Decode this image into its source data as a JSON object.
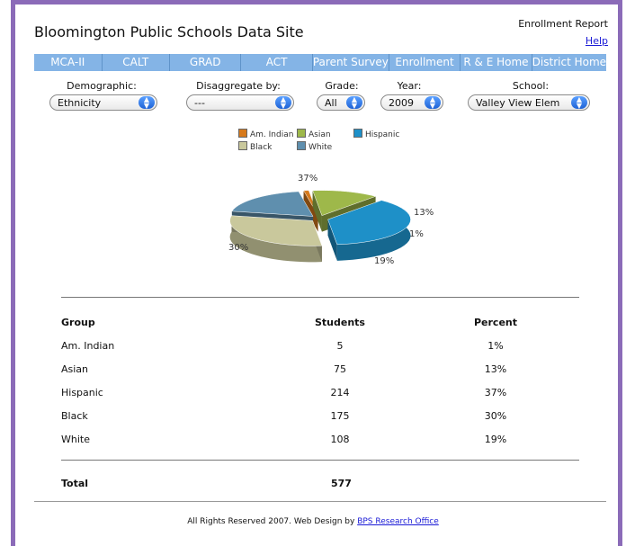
{
  "header": {
    "site_title": "Bloomington Public Schools Data Site",
    "report_title": "Enrollment Report",
    "help_link": "Help"
  },
  "nav": {
    "items": [
      "MCA-II",
      "CALT",
      "GRAD",
      "ACT",
      "Parent Survey",
      "Enrollment",
      "R & E Home",
      "District Home"
    ]
  },
  "filters": {
    "demographic": {
      "label": "Demographic:",
      "value": "Ethnicity"
    },
    "disaggregate": {
      "label": "Disaggregate by:",
      "value": "---"
    },
    "grade": {
      "label": "Grade:",
      "value": "All"
    },
    "year": {
      "label": "Year:",
      "value": "2009"
    },
    "school": {
      "label": "School:",
      "value": "Valley View Elem"
    }
  },
  "chart_data": {
    "type": "pie",
    "categories": [
      "Am. Indian",
      "Asian",
      "Hispanic",
      "Black",
      "White"
    ],
    "values": [
      1,
      13,
      37,
      30,
      19
    ],
    "labels": [
      "1%",
      "13%",
      "37%",
      "30%",
      "19%"
    ],
    "colors": [
      "#d77a1c",
      "#9eb84a",
      "#1e90c8",
      "#c9c89c",
      "#5f8fae"
    ],
    "legend_position": "top"
  },
  "table": {
    "headers": [
      "Group",
      "Students",
      "Percent"
    ],
    "rows": [
      [
        "Am. Indian",
        "5",
        "1%"
      ],
      [
        "Asian",
        "75",
        "13%"
      ],
      [
        "Hispanic",
        "214",
        "37%"
      ],
      [
        "Black",
        "175",
        "30%"
      ],
      [
        "White",
        "108",
        "19%"
      ]
    ],
    "total_label": "Total",
    "total_value": "577"
  },
  "footer": {
    "text": "All Rights Reserved 2007. Web Design by ",
    "link": "BPS Research Office"
  }
}
